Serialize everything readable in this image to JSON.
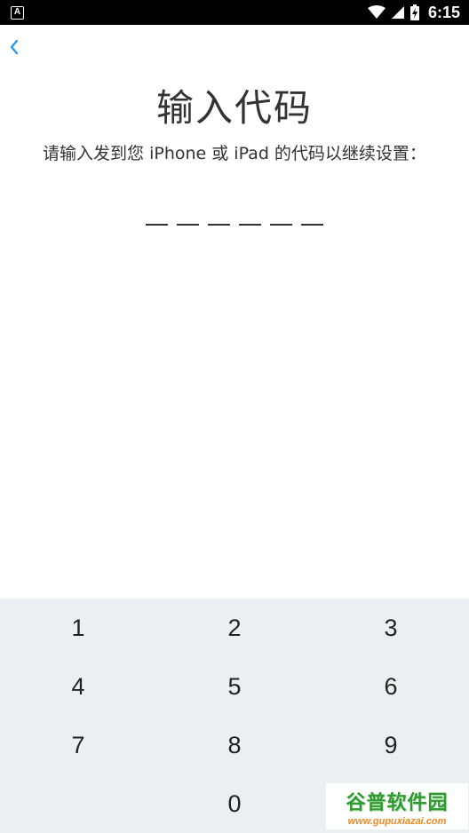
{
  "status_bar": {
    "app_badge": "A",
    "time": "6:15"
  },
  "title": "输入代码",
  "subtitle": "请输入发到您 iPhone 或 iPad 的代码以继续设置：",
  "code_length": 6,
  "keypad": {
    "keys": [
      "1",
      "2",
      "3",
      "4",
      "5",
      "6",
      "7",
      "8",
      "9",
      "",
      "0",
      ""
    ]
  },
  "watermark": {
    "title": "谷普软件园",
    "url": "www.gupuxiazai.com"
  },
  "colors": {
    "accent": "#2196f3",
    "keypad_bg": "#eceff1",
    "text": "#333333"
  }
}
